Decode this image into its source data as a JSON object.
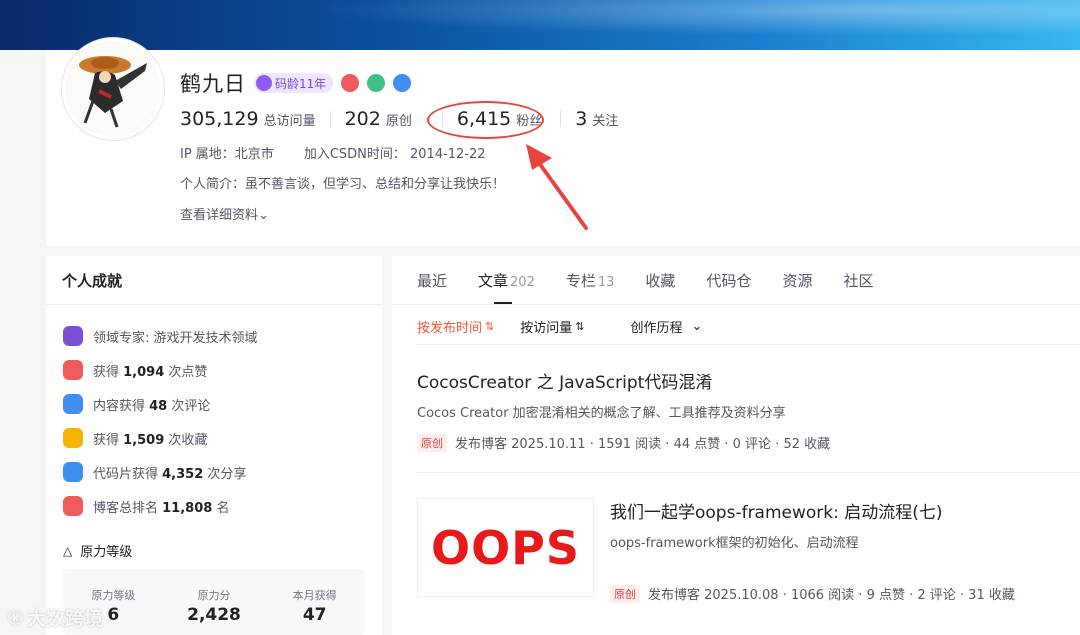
{
  "profile": {
    "name": "鹤九日",
    "age_badge": "码龄11年",
    "stats": [
      {
        "value": "305,129",
        "label": "总访问量"
      },
      {
        "value": "202",
        "label": "原创"
      },
      {
        "value": "6,415",
        "label": "粉丝"
      },
      {
        "value": "3",
        "label": "关注"
      }
    ],
    "ip": "IP 属地：北京市",
    "joined": "加入CSDN时间：  2014-12-22",
    "bio": "个人简介：虽不善言谈，但学习、总结和分享让我快乐！",
    "more": "查看详细资料",
    "colors": {
      "highlight": "#e8443f",
      "accent": "#fc5531"
    }
  },
  "achievements": {
    "title": "个人成就",
    "items": [
      {
        "prefix": "领域专家: ",
        "bold": "",
        "suffix": "游戏开发技术领域",
        "icon": "expert-icon",
        "color": "#7b4fd6"
      },
      {
        "prefix": "获得 ",
        "bold": "1,094",
        "suffix": " 次点赞",
        "icon": "like-icon",
        "color": "#f05a5a"
      },
      {
        "prefix": "内容获得 ",
        "bold": "48",
        "suffix": " 次评论",
        "icon": "comment-icon",
        "color": "#3f8ef0"
      },
      {
        "prefix": "获得 ",
        "bold": "1,509",
        "suffix": " 次收藏",
        "icon": "favorite-icon",
        "color": "#f5b400"
      },
      {
        "prefix": "代码片获得 ",
        "bold": "4,352",
        "suffix": " 次分享",
        "icon": "code-icon",
        "color": "#3f8ef0"
      },
      {
        "prefix": "博客总排名 ",
        "bold": "11,808",
        "suffix": " 名",
        "icon": "rank-icon",
        "color": "#f05a5a"
      }
    ],
    "level_title": "原力等级",
    "level": [
      {
        "label": "原力等级",
        "value": "6"
      },
      {
        "label": "原力分",
        "value": "2,428"
      },
      {
        "label": "本月获得",
        "value": "47"
      }
    ]
  },
  "tabs": [
    {
      "label": "最近",
      "count": ""
    },
    {
      "label": "文章",
      "count": "202"
    },
    {
      "label": "专栏",
      "count": "13"
    },
    {
      "label": "收藏",
      "count": ""
    },
    {
      "label": "代码仓",
      "count": ""
    },
    {
      "label": "资源",
      "count": ""
    },
    {
      "label": "社区",
      "count": ""
    }
  ],
  "sort": {
    "by_date": "按发布时间",
    "by_views": "按访问量",
    "history": "创作历程"
  },
  "articles": [
    {
      "title": "CocosCreator 之 JavaScript代码混淆",
      "desc": "Cocos Creator 加密混淆相关的概念了解、工具推荐及资料分享",
      "tag": "原创",
      "meta": "发布博客 2025.10.11 · 1591 阅读 · 44 点赞 · 0 评论 · 52 收藏"
    },
    {
      "title": "我们一起学oops-framework: 启动流程(七)",
      "desc": "oops-framework框架的初始化、启动流程",
      "tag": "原创",
      "meta": "发布博客 2025.10.08 · 1066 阅读 · 9 点赞 · 2 评论 · 31 收藏",
      "thumb_text": "OOPS"
    }
  ],
  "watermark": "大数跨境"
}
